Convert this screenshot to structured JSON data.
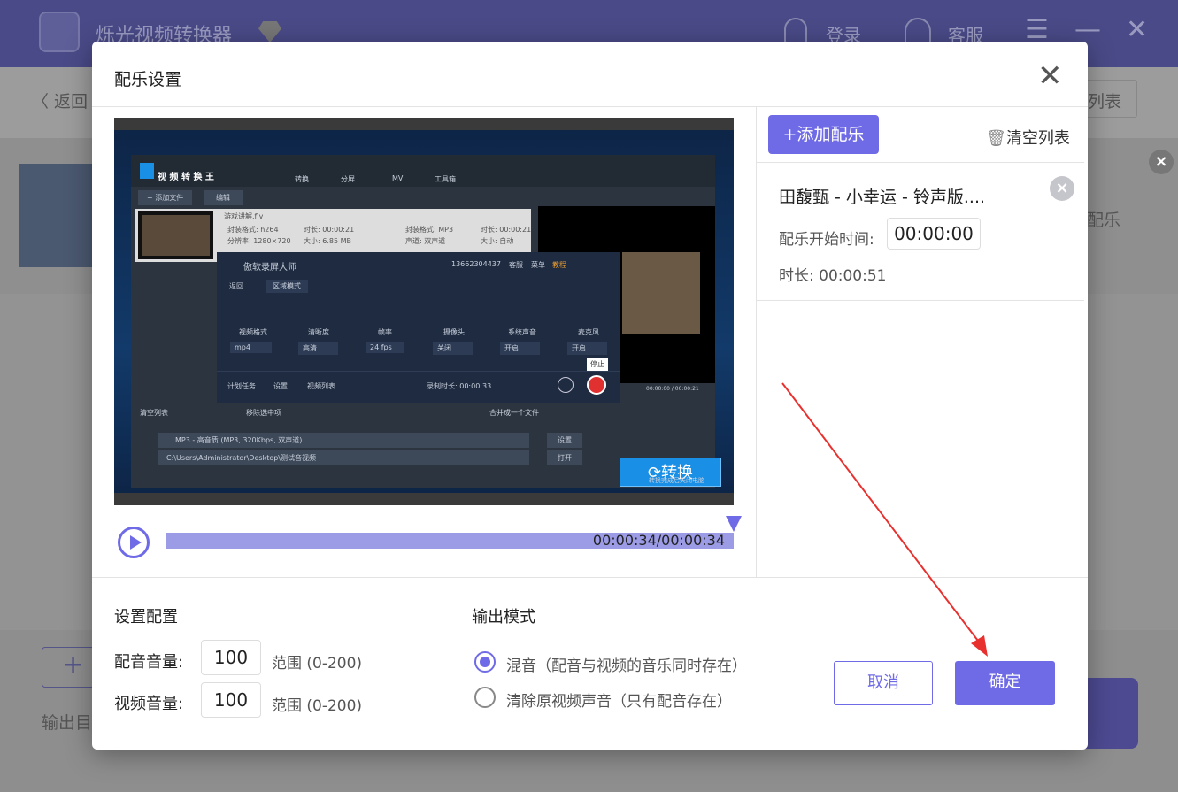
{
  "app": {
    "title": "烁光视频转换器",
    "login": "登录",
    "service": "客服",
    "back": "返回",
    "list_btn": "列表",
    "music_label": "配乐",
    "add_symbol": "+",
    "output_dir": "输出目"
  },
  "dialog": {
    "title": "配乐设置",
    "preview": {
      "converter_title": "视 频 转 换 王",
      "tabs": [
        "转换",
        "分屏",
        "MV",
        "工具箱"
      ],
      "add_file": "+ 添加文件",
      "edit": "编辑",
      "file_name": "游戏讲解.flv",
      "file_info": [
        "封装格式: h264",
        "时长: 00:00:21",
        "分辨率: 1280×720",
        "大小: 6.85 MB",
        "封装格式: MP3",
        "时长: 00:00:21",
        "声道: 双声道",
        "大小: 自动"
      ],
      "recorder_title": "傲软录屏大师",
      "recorder_phone": "13662304437",
      "recorder_menu": [
        "客服",
        "菜单",
        "教程"
      ],
      "recorder_back": "返回",
      "recorder_mode": "区域模式",
      "recorder_items": [
        {
          "label": "视频格式",
          "value": "mp4"
        },
        {
          "label": "清晰度",
          "value": "高清"
        },
        {
          "label": "帧率",
          "value": "24 fps"
        },
        {
          "label": "摄像头",
          "value": "关闭"
        },
        {
          "label": "系统声音",
          "value": "开启"
        },
        {
          "label": "麦克风",
          "value": "开启"
        }
      ],
      "recorder_footer": [
        "计划任务",
        "设置",
        "视频列表"
      ],
      "record_time": "录制时长: 00:00:33",
      "stop_tip": "停止",
      "clear_list": "清空列表",
      "remove_selected": "移除选中项",
      "merge": "合并成一个文件",
      "output_format": "MP3 - 高音质 (MP3, 320Kbps, 双声道)",
      "output_dir": "C:\\Users\\Administrator\\Desktop\\测试音视频",
      "settings": "设置",
      "open": "打开",
      "convert": "转换",
      "video_time": "00:00:00 / 00:00:21",
      "shutdown": "转换完成后关闭电脑"
    },
    "player": {
      "time": "00:00:34/00:00:34",
      "progress": 1.0
    },
    "music_list": {
      "add_label": "+添加配乐",
      "clear_label": "清空列表",
      "items": [
        {
          "name": "田馥甄 - 小幸运 - 铃声版....",
          "start_label": "配乐开始时间:",
          "start_time": "00:00:00",
          "duration": "时长: 00:00:51"
        }
      ]
    },
    "config": {
      "title": "设置配置",
      "dub_label": "配音音量:",
      "dub_value": "100",
      "video_label": "视频音量:",
      "video_value": "100",
      "range": "范围 (0-200)"
    },
    "output_mode": {
      "title": "输出模式",
      "options": [
        "混音（配音与视频的音乐同时存在）",
        "清除原视频声音（只有配音存在）"
      ],
      "selected": 0
    },
    "cancel": "取消",
    "confirm": "确定"
  },
  "colors": {
    "accent": "#6f6ae6",
    "annotation": "#e8312f"
  }
}
